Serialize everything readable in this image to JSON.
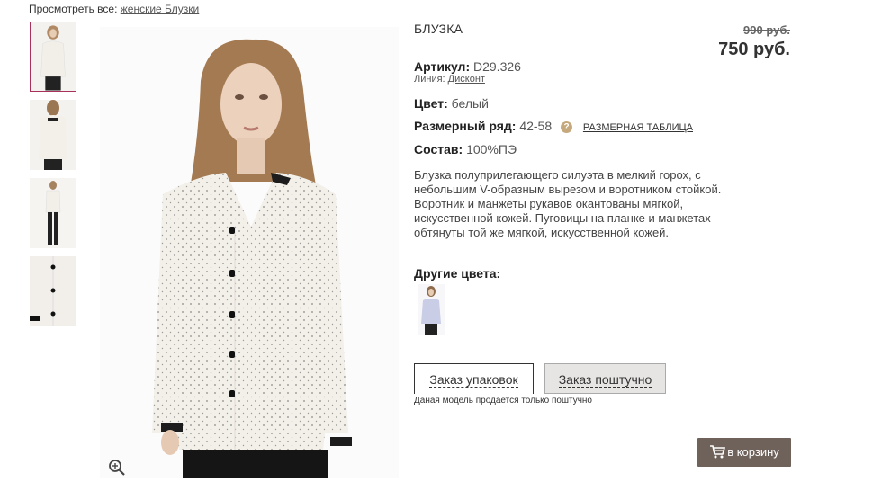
{
  "breadcrumb": {
    "prefix": "Просмотреть все:",
    "link": "женские Блузки"
  },
  "product": {
    "title": "БЛУЗКА",
    "old_price": "990 руб.",
    "price": "750 руб.",
    "article_label": "Артикул:",
    "article_value": "D29.326",
    "line_label": "Линия:",
    "line_value": "Дисконт",
    "color_label": "Цвет:",
    "color_value": "белый",
    "size_label": "Размерный ряд:",
    "size_value": "42-58",
    "size_table_icon": "?",
    "size_table_link": "РАЗМЕРНАЯ ТАБЛИЦА",
    "composition_label": "Состав:",
    "composition_value": "100%ПЭ",
    "description": "Блузка полуприлегающего силуэта в мелкий горох, с небольшим V-образным вырезом и воротником стойкой. Воротник и манжеты рукавов окантованы мягкой, искусственной кожей. Пуговицы на планке и манжетах обтянуты той же мягкой, искусственной кожей.",
    "other_colors_label": "Другие цвета:"
  },
  "order_tabs": {
    "pack": "Заказ упаковок",
    "single": "Заказ поштучно",
    "note": "Даная модель продается только поштучно"
  },
  "cart_button": "в корзину",
  "colors": {
    "accent": "#a8315b",
    "cart_bg": "#6f625b",
    "tab_inactive_bg": "#e7e5e4",
    "help_icon": "#c6a87d"
  },
  "icons": {
    "zoom": "zoom-in-icon",
    "cart": "cart-icon",
    "help": "question-icon"
  }
}
